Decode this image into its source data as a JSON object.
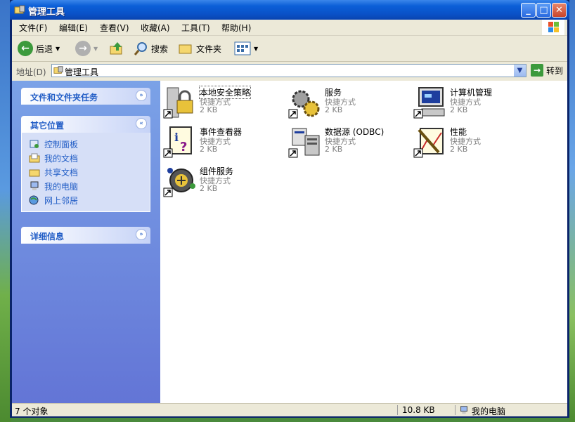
{
  "window": {
    "title": "管理工具"
  },
  "menu": [
    "文件(F)",
    "编辑(E)",
    "查看(V)",
    "收藏(A)",
    "工具(T)",
    "帮助(H)"
  ],
  "toolbar": {
    "back": "后退",
    "search": "搜索",
    "folders": "文件夹"
  },
  "address": {
    "label": "地址(D)",
    "value": "管理工具",
    "go": "转到"
  },
  "left_panel": {
    "tasks_title": "文件和文件夹任务",
    "other_title": "其它位置",
    "other_links": [
      "控制面板",
      "我的文档",
      "共享文档",
      "我的电脑",
      "网上邻居"
    ],
    "details_title": "详细信息"
  },
  "items": [
    {
      "name": "本地安全策略",
      "type": "快捷方式",
      "size": "2 KB"
    },
    {
      "name": "服务",
      "type": "快捷方式",
      "size": "2 KB"
    },
    {
      "name": "计算机管理",
      "type": "快捷方式",
      "size": "2 KB"
    },
    {
      "name": "事件查看器",
      "type": "快捷方式",
      "size": "2 KB"
    },
    {
      "name": "数据源 (ODBC)",
      "type": "快捷方式",
      "size": "2 KB"
    },
    {
      "name": "性能",
      "type": "快捷方式",
      "size": "2 KB"
    },
    {
      "name": "组件服务",
      "type": "快捷方式",
      "size": "2 KB"
    }
  ],
  "status": {
    "count": "7 个对象",
    "size": "10.8 KB",
    "location": "我的电脑"
  },
  "colors": {
    "titlebar": "#0a52c8",
    "task_pane": "#6f8fde",
    "link": "#215dc6"
  }
}
